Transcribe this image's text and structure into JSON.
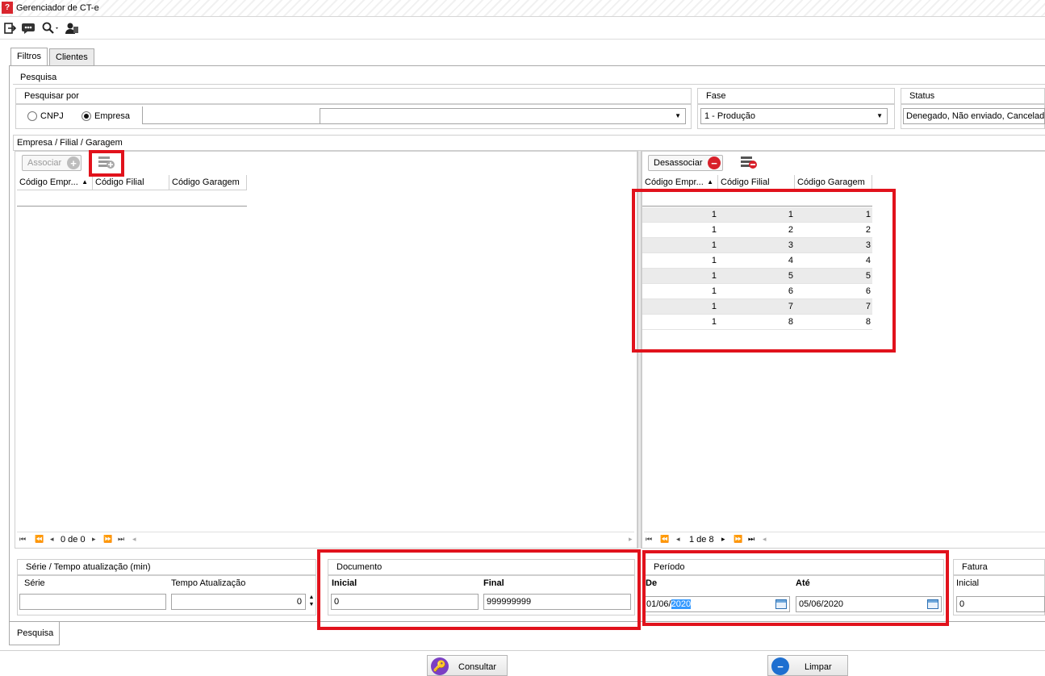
{
  "window": {
    "title": "Gerenciador de CT-e",
    "app_icon": "app-logo-icon"
  },
  "toolbar": {
    "icons": [
      "exit-icon",
      "chat-icon",
      "search-icon",
      "users-icon"
    ]
  },
  "tabs": {
    "filtros": "Filtros",
    "clientes": "Clientes"
  },
  "pesquisa": {
    "title": "Pesquisa",
    "pesquisar_por": {
      "title": "Pesquisar por",
      "cnpj_label": "CNPJ",
      "empresa_label": "Empresa",
      "selected": "Empresa",
      "combo_value": ""
    },
    "fase": {
      "title": "Fase",
      "value": "1 - Produção"
    },
    "status": {
      "title": "Status",
      "value": "Denegado, Não enviado, Cancelado"
    }
  },
  "empresa_group": {
    "title": "Empresa / Filial / Garagem"
  },
  "left_grid": {
    "associar_label": "Associar",
    "columns": [
      "Código Empr...",
      "Código Filial",
      "Código Garagem"
    ],
    "rows": [],
    "pager_text": "0 de 0"
  },
  "right_grid": {
    "desassociar_label": "Desassociar",
    "columns": [
      "Código Empr...",
      "Código Filial",
      "Código Garagem"
    ],
    "rows": [
      [
        "1",
        "1",
        "1"
      ],
      [
        "1",
        "2",
        "2"
      ],
      [
        "1",
        "3",
        "3"
      ],
      [
        "1",
        "4",
        "4"
      ],
      [
        "1",
        "5",
        "5"
      ],
      [
        "1",
        "6",
        "6"
      ],
      [
        "1",
        "7",
        "7"
      ],
      [
        "1",
        "8",
        "8"
      ]
    ],
    "pager_text": "1 de 8"
  },
  "serie_group": {
    "title": "Série / Tempo atualização (min)",
    "serie_label": "Série",
    "serie_value": "",
    "tempo_label": "Tempo Atualização",
    "tempo_value": "0"
  },
  "documento": {
    "title": "Documento",
    "inicial_label": "Inicial",
    "inicial_value": "0",
    "final_label": "Final",
    "final_value": "999999999"
  },
  "periodo": {
    "title": "Período",
    "de_label": "De",
    "de_day_month": "01/06/",
    "de_year_selected": "2020",
    "ate_label": "Até",
    "ate_value": "05/06/2020"
  },
  "fatura": {
    "title": "Fatura",
    "inicial_label": "Inicial",
    "inicial_value": "0"
  },
  "bottom_tab": {
    "label": "Pesquisa"
  },
  "actions": {
    "consultar": "Consultar",
    "limpar": "Limpar"
  },
  "colors": {
    "highlight_red": "#e1121c",
    "selection_blue": "#3399ff",
    "app_red": "#d9262e"
  }
}
